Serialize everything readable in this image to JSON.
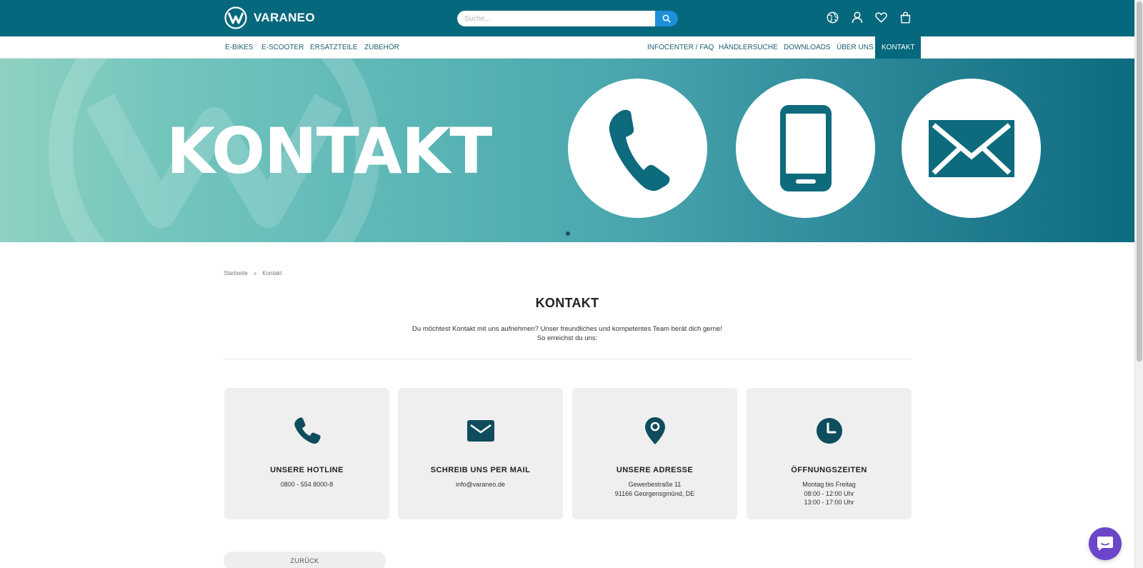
{
  "header": {
    "logo_text": "VARANEO",
    "search_placeholder": "Suche...",
    "icons": [
      "globe-icon",
      "user-icon",
      "heart-icon",
      "bag-icon"
    ]
  },
  "nav": {
    "left": [
      "E-BIKES",
      "E-SCOOTER",
      "ERSATZTEILE",
      "ZUBEHÖR"
    ],
    "right": [
      "INFOCENTER / FAQ",
      "HÄNDLERSUCHE",
      "DOWNLOADS",
      "ÜBER UNS",
      "KONTAKT"
    ],
    "active": "KONTAKT"
  },
  "hero": {
    "title": "KONTAKT",
    "icons": [
      "phone-icon",
      "smartphone-icon",
      "envelope-icon"
    ]
  },
  "breadcrumb": {
    "home": "Startseite",
    "separator": "»",
    "current": "Kontakt"
  },
  "page": {
    "title": "KONTAKT",
    "intro_line1": "Du möchtest Kontakt mit uns aufnehmen? Unser freundliches und kompetentes Team berät dich gerne!",
    "intro_line2": "So erreichst du uns:"
  },
  "cards": [
    {
      "title": "UNSERE HOTLINE",
      "lines": [
        "0800 - 554 8000-8"
      ],
      "icon": "phone-icon"
    },
    {
      "title": "SCHREIB UNS PER MAIL",
      "lines": [
        "info@varaneo.de"
      ],
      "icon": "mail-icon"
    },
    {
      "title": "UNSERE ADRESSE",
      "lines": [
        "Gewerbestraße 11",
        "91166 Georgensgmünd, DE"
      ],
      "icon": "location-pin-icon"
    },
    {
      "title": "ÖFFNUNGSZEITEN",
      "lines": [
        "Montag bis Freitag",
        "08:00 - 12:00 Uhr",
        "13:00 - 17:00 Uhr"
      ],
      "icon": "clock-icon"
    }
  ],
  "back_button": "ZURÜCK",
  "colors": {
    "brand": "#05687d",
    "search_button": "#1e8fd9",
    "chat_button": "#6b46c9",
    "icon_dark": "#0e4c5e"
  }
}
